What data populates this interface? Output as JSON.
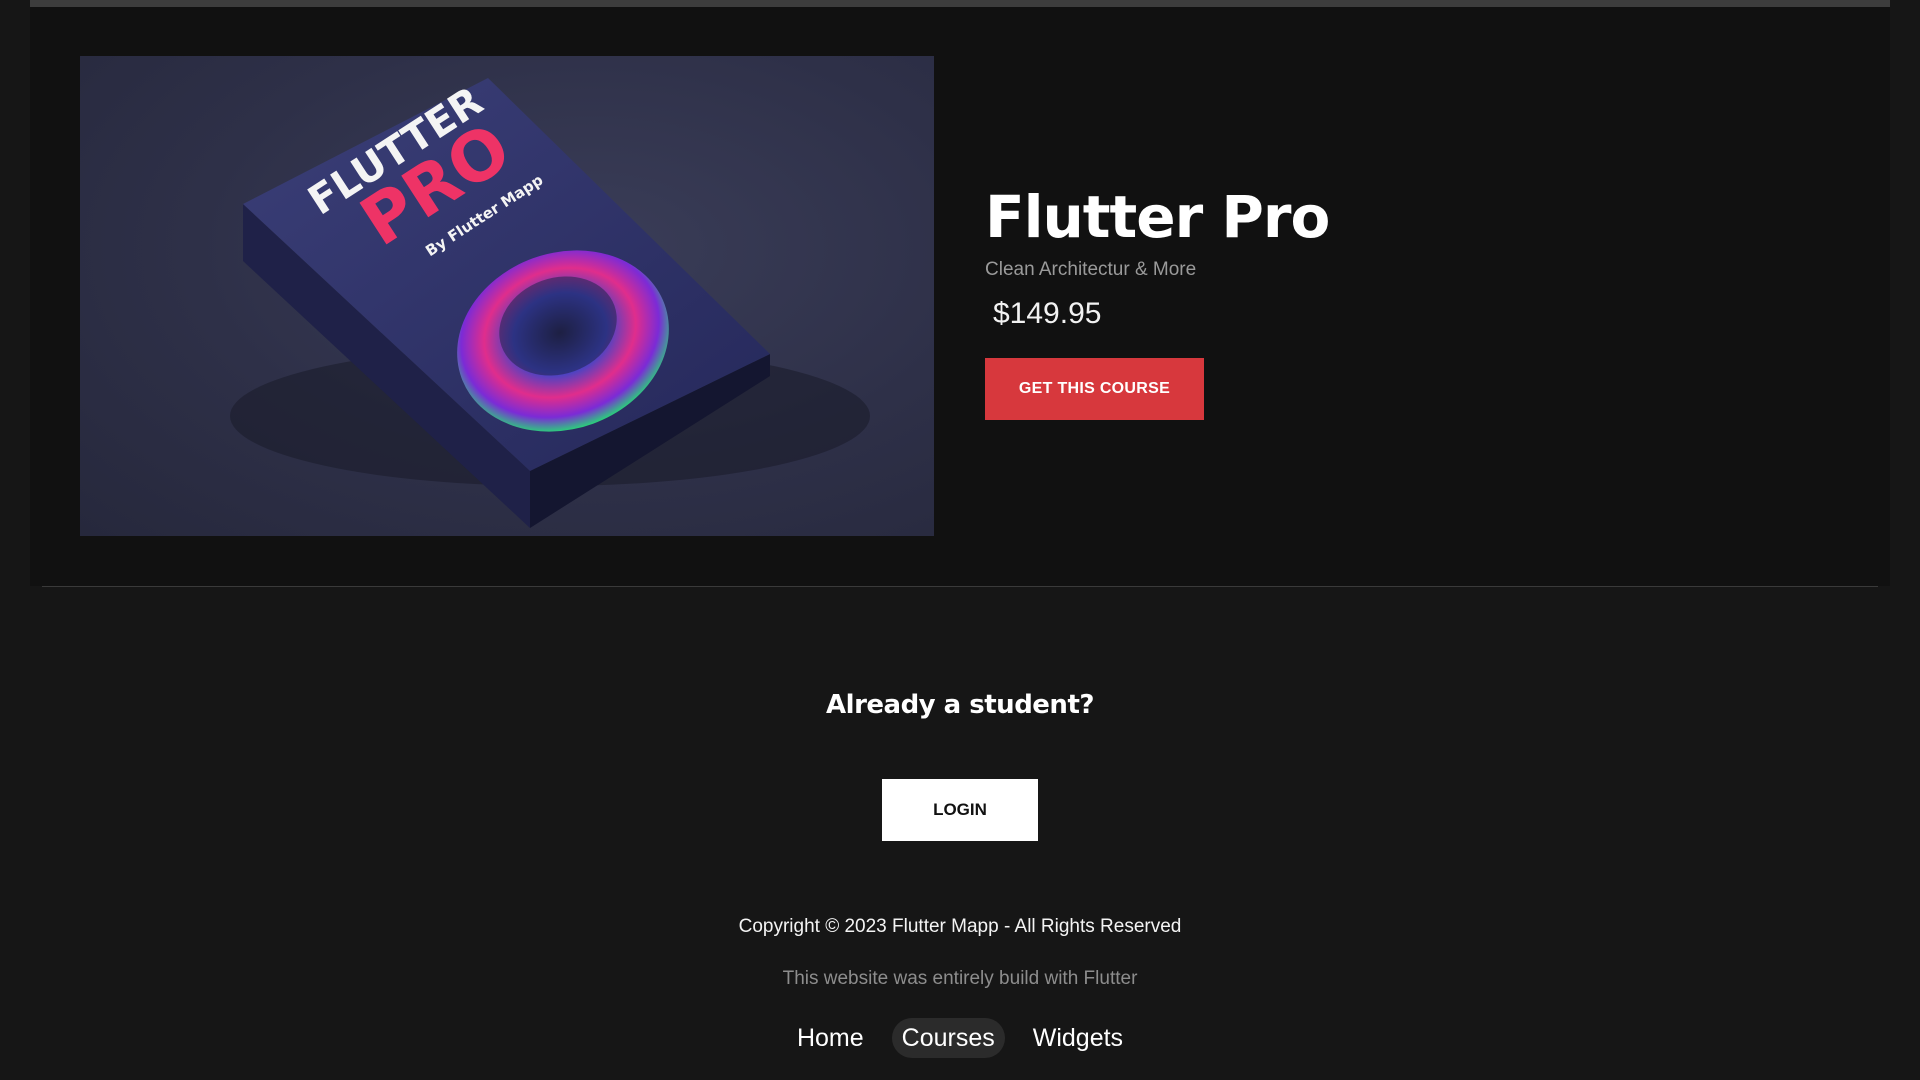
{
  "course": {
    "cover": {
      "brand_line1": "FLUTTER",
      "brand_line2": "PRO",
      "brand_line3": "By Flutter Mapp"
    },
    "title": "Flutter Pro",
    "subtitle": "Clean Architectur & More",
    "price": "$149.95",
    "cta_label": "GET THIS COURSE",
    "cta_color": "#d7383d"
  },
  "student": {
    "heading": "Already a student?",
    "login_label": "LOGIN"
  },
  "footer": {
    "copyright": "Copyright © 2023 Flutter Mapp - All Rights Reserved",
    "built_with": "This website was entirely build with Flutter",
    "nav": [
      {
        "label": "Home",
        "active": false
      },
      {
        "label": "Courses",
        "active": true
      },
      {
        "label": "Widgets",
        "active": false
      }
    ]
  }
}
